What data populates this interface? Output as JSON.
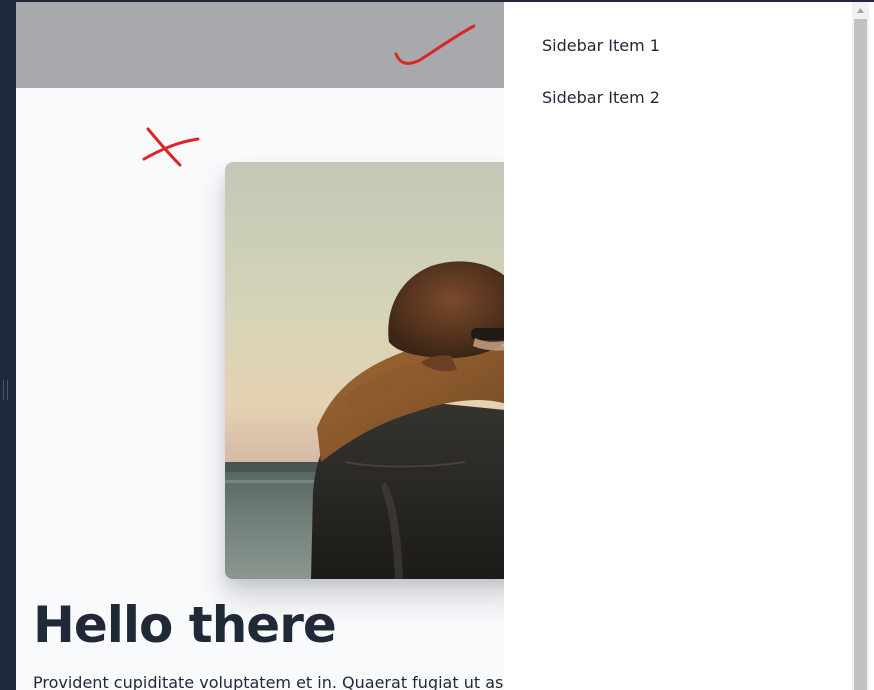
{
  "hero": {
    "title": "Hello there",
    "body": "Provident cupiditate voluptatem et in. Quaerat fugiat ut assun"
  },
  "sidebar": {
    "items": [
      {
        "label": "Sidebar Item 1"
      },
      {
        "label": "Sidebar Item 2"
      }
    ]
  },
  "annotations": {
    "checkmark_icon": "checkmark-icon",
    "cross_icon": "cross-icon",
    "color": "#dc2626"
  },
  "colors": {
    "header_band": "#a8a9ac",
    "page_background": "#f8fafc",
    "text": "#1f2937",
    "frame": "#1e293b"
  }
}
